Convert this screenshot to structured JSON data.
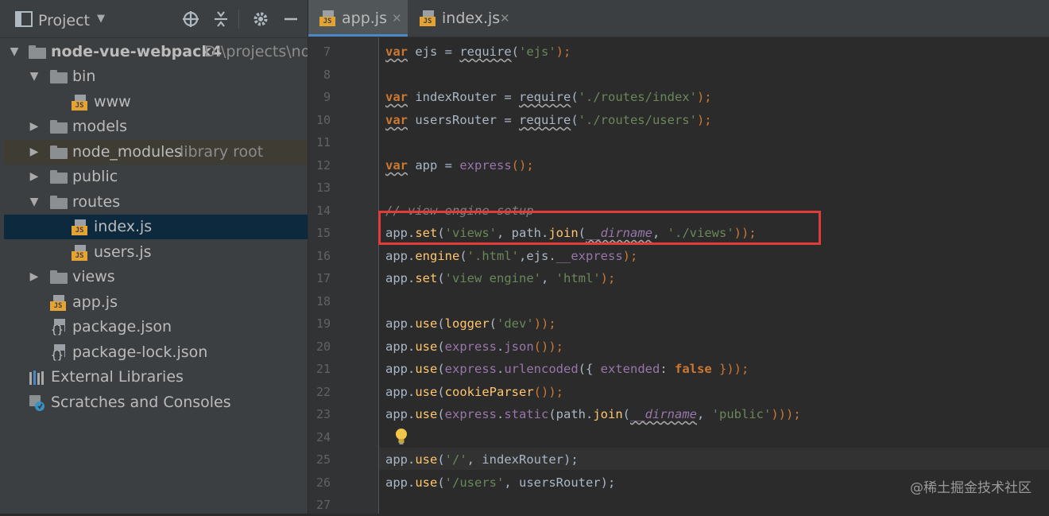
{
  "project_panel": {
    "title": "Project",
    "tree": [
      {
        "name": "node-vue-webpack4",
        "hint": "D:\\projects\\noc",
        "type": "folder",
        "expanded": true
      },
      {
        "name": "bin",
        "type": "folder",
        "expanded": true
      },
      {
        "name": "www",
        "type": "js"
      },
      {
        "name": "models",
        "type": "folder",
        "expanded": false
      },
      {
        "name": "node_modules",
        "hint": "library root",
        "type": "folder",
        "expanded": false
      },
      {
        "name": "public",
        "type": "folder",
        "expanded": false
      },
      {
        "name": "routes",
        "type": "folder",
        "expanded": true
      },
      {
        "name": "index.js",
        "type": "js",
        "selected": true
      },
      {
        "name": "users.js",
        "type": "js"
      },
      {
        "name": "views",
        "type": "folder",
        "expanded": false
      },
      {
        "name": "app.js",
        "type": "js"
      },
      {
        "name": "package.json",
        "type": "json"
      },
      {
        "name": "package-lock.json",
        "type": "json"
      },
      {
        "name": "External Libraries",
        "type": "libraries"
      },
      {
        "name": "Scratches and Consoles",
        "type": "scratches"
      }
    ]
  },
  "editor": {
    "tabs": [
      {
        "label": "app.js",
        "active": true
      },
      {
        "label": "index.js",
        "active": false
      }
    ],
    "line_numbers": [
      "7",
      "8",
      "9",
      "10",
      "11",
      "12",
      "13",
      "14",
      "15",
      "16",
      "17",
      "18",
      "19",
      "20",
      "21",
      "22",
      "23",
      "24",
      "25",
      "26",
      "27"
    ],
    "code": {
      "l7": {
        "t1": "var",
        "t2": " ejs = ",
        "t3": "require",
        "t4": "(",
        "t5": "'ejs'",
        "t6": ");"
      },
      "l9": {
        "t1": "var",
        "t2": " indexRouter = ",
        "t3": "require",
        "t4": "(",
        "t5": "'./routes/index'",
        "t6": ");"
      },
      "l10": {
        "t1": "var",
        "t2": " usersRouter = ",
        "t3": "require",
        "t4": "(",
        "t5": "'./routes/users'",
        "t6": ");"
      },
      "l12": {
        "t1": "var",
        "t2": " app = ",
        "t3": "express",
        "t4": "();"
      },
      "l14": {
        "t1": "// view engine setup"
      },
      "l15": {
        "t1": "app.",
        "t2": "set",
        "t3": "(",
        "t4": "'views'",
        "t5": ", path.",
        "t6": "join",
        "t7": "(",
        "t8": "__dirname",
        "t9": ", ",
        "t10": "'./views'",
        "t11": "));"
      },
      "l16": {
        "t1": "app.",
        "t2": "engine",
        "t3": "(",
        "t4": "'.html'",
        "t5": ",ejs.",
        "t6": "__express",
        "t7": ");"
      },
      "l17": {
        "t1": "app.",
        "t2": "set",
        "t3": "(",
        "t4": "'view engine'",
        "t5": ", ",
        "t6": "'html'",
        "t7": ");"
      },
      "l19": {
        "t1": "app.",
        "t2": "use",
        "t3": "(",
        "t4": "logger",
        "t5": "(",
        "t6": "'dev'",
        "t7": "));"
      },
      "l20": {
        "t1": "app.",
        "t2": "use",
        "t3": "(",
        "t4": "express",
        "t5": ".",
        "t6": "json",
        "t7": "());"
      },
      "l21": {
        "t1": "app.",
        "t2": "use",
        "t3": "(",
        "t4": "express",
        "t5": ".",
        "t6": "urlencoded",
        "t7": "({ ",
        "t8": "extended",
        "t9": ": ",
        "t10": "false",
        "t11": " }));"
      },
      "l22": {
        "t1": "app.",
        "t2": "use",
        "t3": "(",
        "t4": "cookieParser",
        "t5": "());"
      },
      "l23": {
        "t1": "app.",
        "t2": "use",
        "t3": "(",
        "t4": "express",
        "t5": ".",
        "t6": "static",
        "t7": "(path.",
        "t8": "join",
        "t9": "(",
        "t10": "__dirname",
        "t11": ", ",
        "t12": "'public'",
        "t13": ")));"
      },
      "l25": {
        "t1": "app.",
        "t2": "use",
        "t3": "(",
        "t4": "'/'",
        "t5": ", indexRouter);"
      },
      "l26": {
        "t1": "app.",
        "t2": "use",
        "t3": "(",
        "t4": "'/users'",
        "t5": ", usersRouter);"
      }
    }
  },
  "watermark": "@稀土掘金技术社区",
  "colors": {
    "highlight_box": "#e23b3b",
    "keyword": "#cc7832",
    "string": "#6a8759",
    "comment": "#808080"
  }
}
